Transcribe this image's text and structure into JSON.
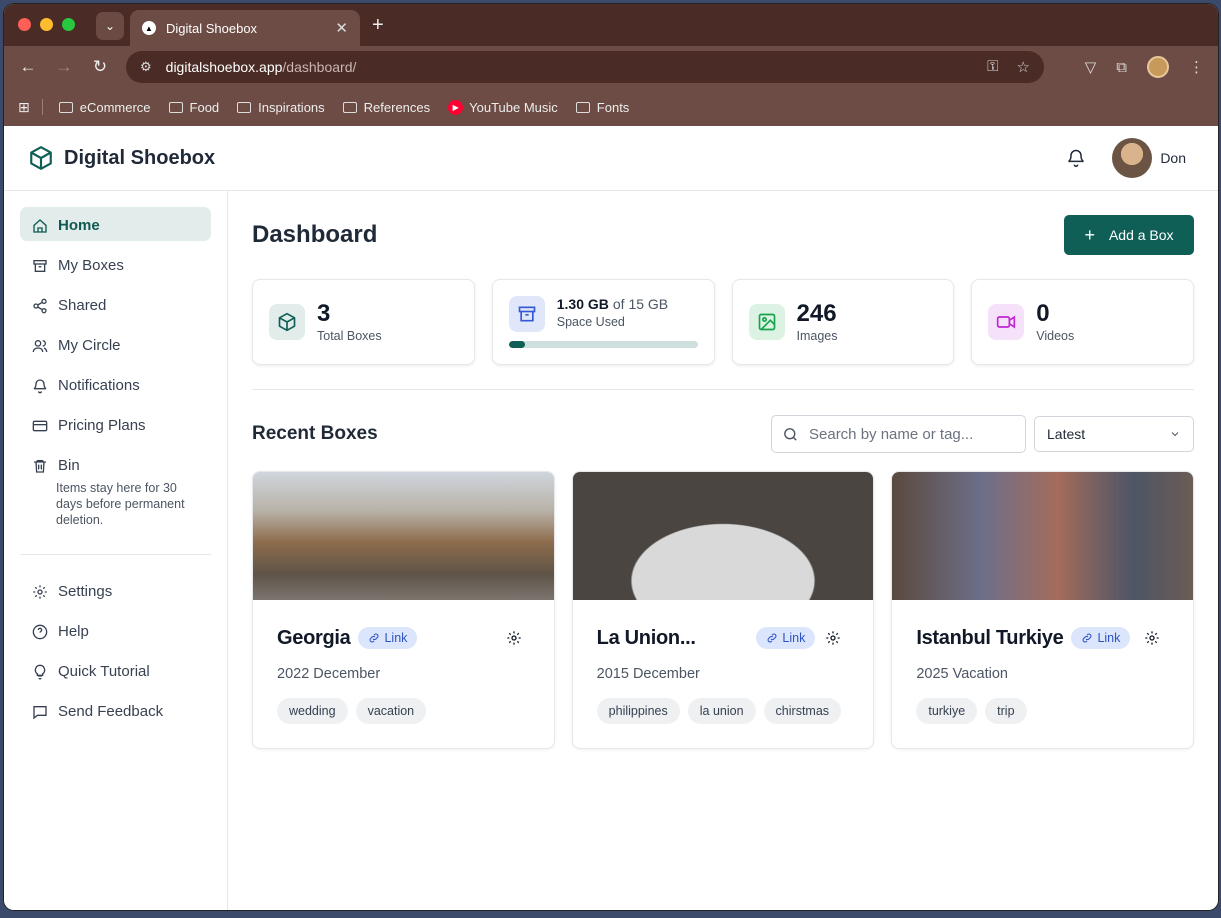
{
  "browser": {
    "tab_title": "Digital Shoebox",
    "url_host": "digitalshoebox.app",
    "url_path": "/dashboard/",
    "bookmarks": [
      {
        "label": "eCommerce",
        "icon": "folder-icon"
      },
      {
        "label": "Food",
        "icon": "folder-icon"
      },
      {
        "label": "Inspirations",
        "icon": "folder-icon"
      },
      {
        "label": "References",
        "icon": "folder-icon"
      },
      {
        "label": "YouTube Music",
        "icon": "youtube-music-icon"
      },
      {
        "label": "Fonts",
        "icon": "folder-icon"
      }
    ]
  },
  "app": {
    "name": "Digital Shoebox",
    "brand_color": "#0f5f57",
    "user_name": "Don"
  },
  "sidebar": {
    "items": [
      {
        "label": "Home",
        "icon": "home-icon",
        "active": true
      },
      {
        "label": "My Boxes",
        "icon": "archive-icon"
      },
      {
        "label": "Shared",
        "icon": "share-icon"
      },
      {
        "label": "My Circle",
        "icon": "users-icon"
      },
      {
        "label": "Notifications",
        "icon": "bell-icon"
      },
      {
        "label": "Pricing Plans",
        "icon": "credit-card-icon"
      },
      {
        "label": "Bin",
        "icon": "trash-icon",
        "note": "Items stay here for 30 days before permanent deletion."
      }
    ],
    "secondary": [
      {
        "label": "Settings",
        "icon": "gear-icon"
      },
      {
        "label": "Help",
        "icon": "help-icon"
      },
      {
        "label": "Quick Tutorial",
        "icon": "lightbulb-icon"
      },
      {
        "label": "Send Feedback",
        "icon": "message-icon"
      }
    ]
  },
  "main": {
    "title": "Dashboard",
    "add_button": "Add a Box",
    "stats": {
      "boxes": {
        "value": "3",
        "label": "Total Boxes"
      },
      "space": {
        "value": "1.30 GB",
        "of": "of 15 GB",
        "label": "Space Used",
        "fraction": 0.087
      },
      "images": {
        "value": "246",
        "label": "Images"
      },
      "videos": {
        "value": "0",
        "label": "Videos"
      }
    },
    "recent_title": "Recent Boxes",
    "search_placeholder": "Search by name or tag...",
    "sort_value": "Latest",
    "link_label": "Link",
    "cards": [
      {
        "title": "Georgia",
        "subtitle": "2022 December",
        "tags": [
          "wedding",
          "vacation"
        ]
      },
      {
        "title": "La Union...",
        "subtitle": "2015 December",
        "tags": [
          "philippines",
          "la union",
          "chirstmas"
        ]
      },
      {
        "title": "Istanbul Turkiye",
        "subtitle": "2025 Vacation",
        "tags": [
          "turkiye",
          "trip"
        ]
      }
    ]
  }
}
